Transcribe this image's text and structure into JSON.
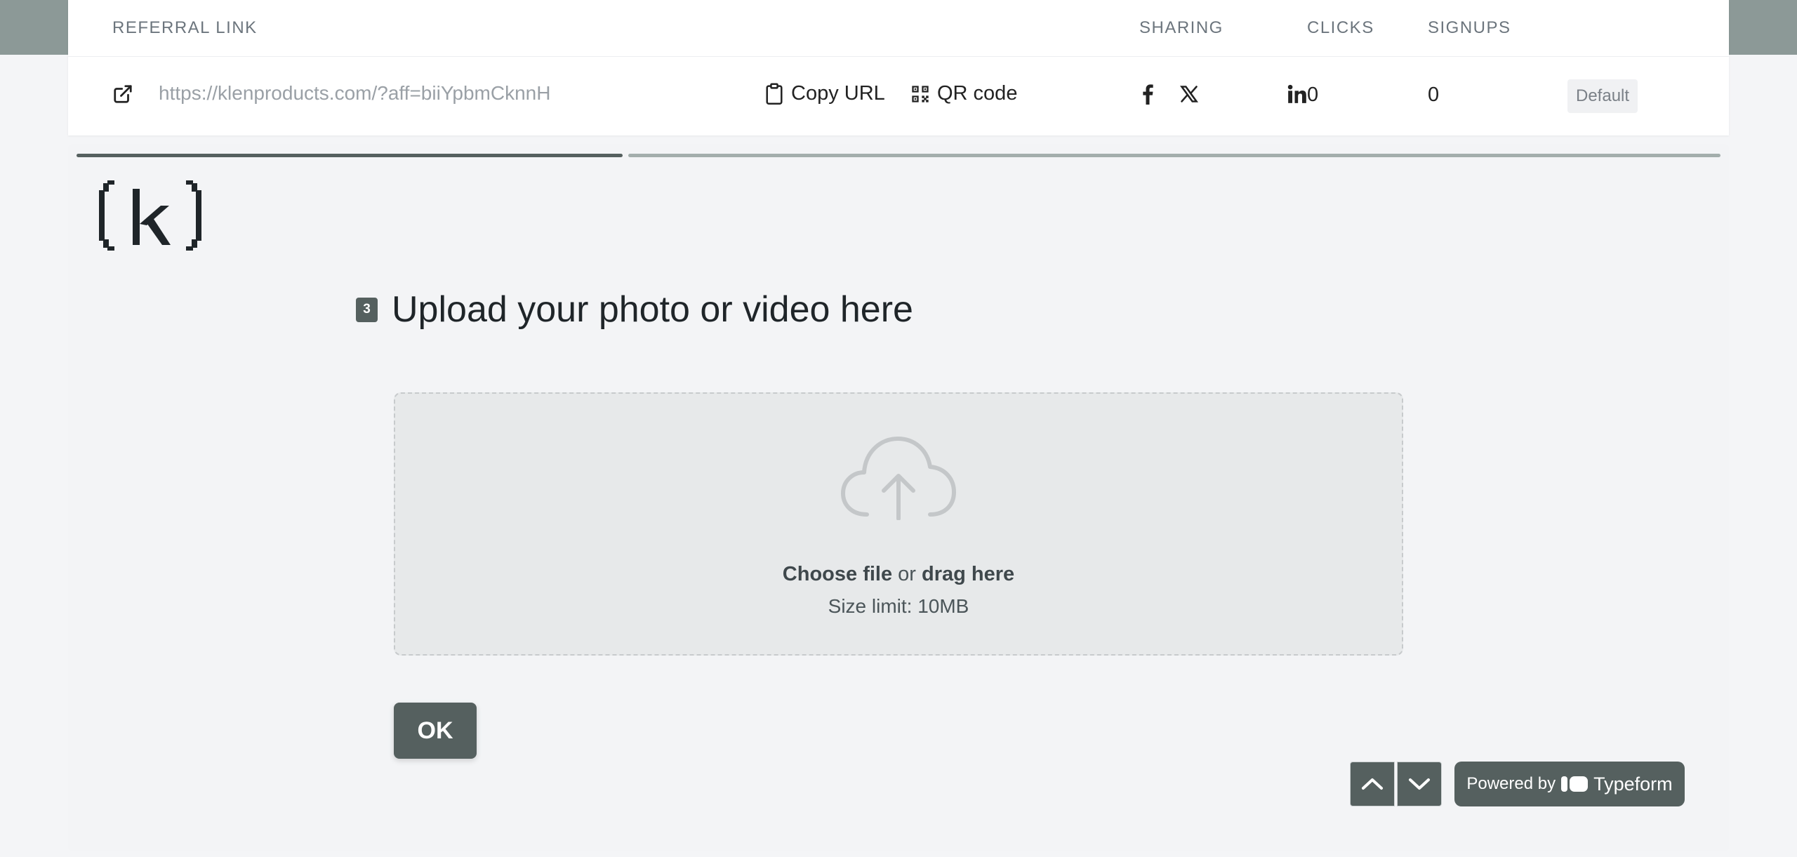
{
  "referral": {
    "headers": {
      "link": "REFERRAL LINK",
      "sharing": "SHARING",
      "clicks": "CLICKS",
      "signups": "SIGNUPS"
    },
    "url": "https://klenproducts.com/?aff=biiYpbmCknnH",
    "copy_url_label": "Copy URL",
    "qr_label": "QR code",
    "social_icons": [
      "facebook-icon",
      "x-icon",
      "linkedin-icon"
    ],
    "clicks": "0",
    "signups": "0",
    "badge": "Default"
  },
  "form": {
    "logo_text": "(k)",
    "progress_fraction": 0.33,
    "question_number": "3",
    "question_title": "Upload your photo or video here",
    "upload": {
      "choose": "Choose file",
      "or": "or",
      "drag": "drag here",
      "size_limit": "Size limit: 10MB"
    },
    "ok_label": "OK",
    "powered_by": "Powered by",
    "brand": "Typeform"
  },
  "colors": {
    "accent": "#55605f",
    "top_band": "#8c9997",
    "progress_track": "#a3aeac",
    "dropzone": "#e7e9ea"
  }
}
